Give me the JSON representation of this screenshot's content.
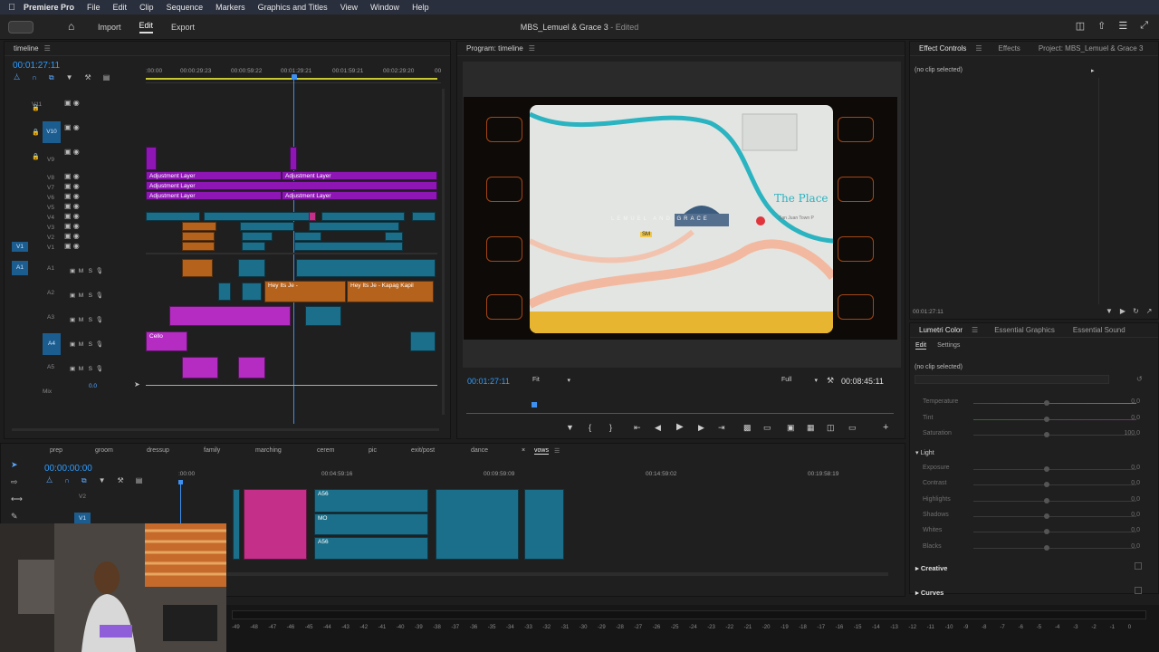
{
  "menubar": {
    "app": "Premiere Pro",
    "items": [
      "File",
      "Edit",
      "Clip",
      "Sequence",
      "Markers",
      "Graphics and Titles",
      "View",
      "Window",
      "Help"
    ]
  },
  "header": {
    "nav": [
      "Import",
      "Edit",
      "Export"
    ],
    "active": "Edit",
    "project_title": "MBS_Lemuel & Grace 3",
    "status": "- Edited"
  },
  "timeline_panel": {
    "title": "timeline",
    "timecode": "00:01:27:11",
    "ruler": [
      ":00:00",
      "00:00:29:23",
      "00:00:59:22",
      "00:01:29:21",
      "00:01:59:21",
      "00:02:29:20",
      "00"
    ],
    "video_tracks": [
      "V11",
      "V10",
      "V9",
      "V8",
      "V7",
      "V6",
      "V5",
      "V4",
      "V3",
      "V2",
      "V1"
    ],
    "audio_tracks": [
      "A1",
      "A2",
      "A3",
      "A4",
      "A5"
    ],
    "mix_label": "Mix",
    "mix_value": "0.0",
    "src_v": "V1",
    "src_a": "A1",
    "adjust_label": "Adjustment Layer",
    "audio_clip_1": "Hey Its Je - ",
    "audio_clip_2": "Hey Its Je - Kapag Kapil",
    "cello_label": "Cello",
    "fx": "fx",
    "track_btn_m": "M",
    "track_btn_s": "S"
  },
  "program_monitor": {
    "title": "Program: timeline",
    "timecode": "00:01:27:11",
    "fit": "Fit",
    "resolution": "Full",
    "duration": "00:08:45:11",
    "frame_text": "LEMUEL AND GRACE",
    "map_label": "The Place",
    "map_sub": "San Juan Town P",
    "shop_sign": "SM"
  },
  "effect_controls": {
    "tabs": [
      "Effect Controls",
      "Effects",
      "Project: MBS_Lemuel & Grace 3"
    ],
    "no_clip": "(no clip selected)",
    "timecode": "00:01:27:11"
  },
  "lumetri": {
    "tabs": [
      "Lumetri Color",
      "Essential Graphics",
      "Essential Sound"
    ],
    "subtabs": [
      "Edit",
      "Settings"
    ],
    "no_clip": "(no clip selected)",
    "rows_wb": [
      {
        "name": "Temperature",
        "value": "0.0"
      },
      {
        "name": "Tint",
        "value": "0.0"
      },
      {
        "name": "Saturation",
        "value": "100.0"
      }
    ],
    "light_label": "Light",
    "rows_light": [
      {
        "name": "Exposure",
        "value": "0.0"
      },
      {
        "name": "Contrast",
        "value": "0.0"
      },
      {
        "name": "Highlights",
        "value": "0.0"
      },
      {
        "name": "Shadows",
        "value": "0.0"
      },
      {
        "name": "Whites",
        "value": "0.0"
      },
      {
        "name": "Blacks",
        "value": "0.0"
      }
    ],
    "creative": "Creative",
    "curves": "Curves"
  },
  "sequence_panel": {
    "tabs": [
      "prep",
      "groom",
      "dressup",
      "family",
      "marching",
      "cerem",
      "pic",
      "exit/post",
      "dance",
      "vows"
    ],
    "active_tab": "vows",
    "timecode": "00:00:00:00",
    "ruler": [
      ":00:00",
      "00:04:59:16",
      "00:09:59:09",
      "00:14:59:02",
      "00:19:58:19"
    ],
    "tracks": [
      "V2",
      "V1"
    ],
    "clip_a": "A56",
    "clip_m": "MO"
  },
  "audio_meter": {
    "scale": [
      "-49",
      "-48",
      "-47",
      "-46",
      "-45",
      "-44",
      "-43",
      "-42",
      "-41",
      "-40",
      "-39",
      "-38",
      "-37",
      "-36",
      "-35",
      "-34",
      "-33",
      "-32",
      "-31",
      "-30",
      "-29",
      "-28",
      "-27",
      "-26",
      "-25",
      "-24",
      "-23",
      "-22",
      "-21",
      "-20",
      "-19",
      "-18",
      "-17",
      "-16",
      "-15",
      "-14",
      "-13",
      "-12",
      "-11",
      "-10",
      "-9",
      "-8",
      "-7",
      "-6",
      "-5",
      "-4",
      "-3",
      "-2",
      "-1",
      "0"
    ]
  }
}
